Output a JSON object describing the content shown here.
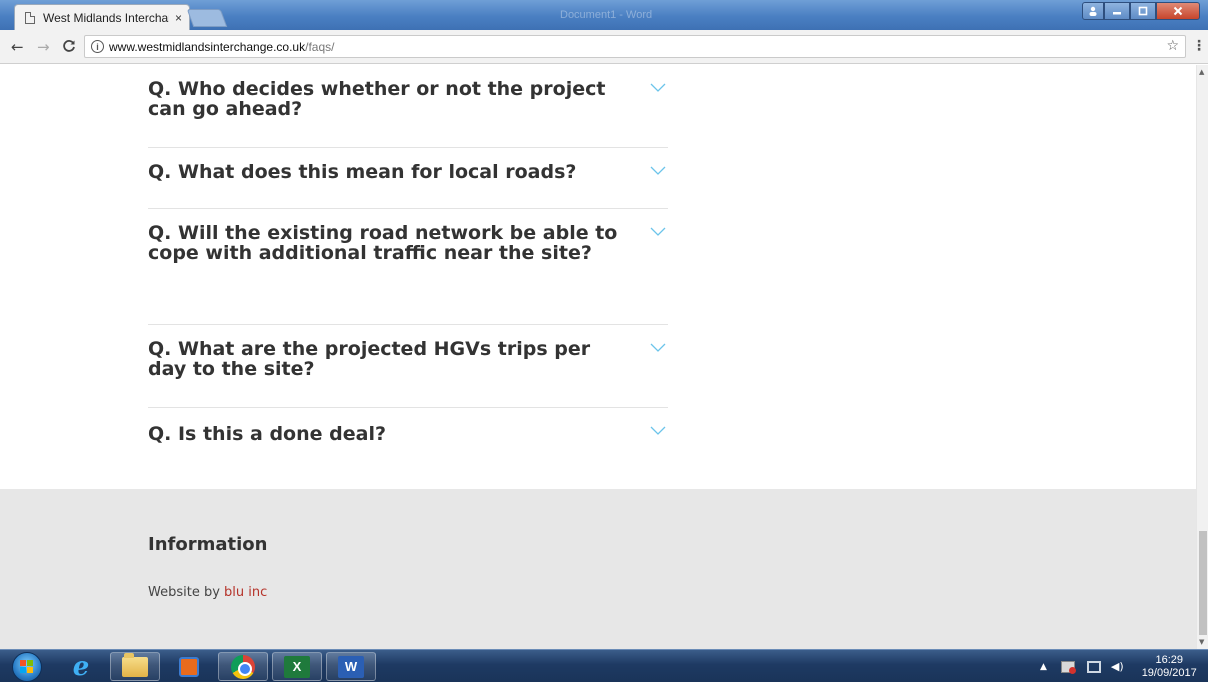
{
  "browser": {
    "tab_title": "West Midlands Interchange",
    "tab_close": "×",
    "window_title": "Document1 - Word",
    "url_host": "www.westmidlandsinterchange.co.uk",
    "url_path": "/faqs/"
  },
  "faqs": [
    {
      "question": "Q. Who decides whether or not the project can go ahead?"
    },
    {
      "question": "Q. What does this mean for local roads?"
    },
    {
      "question": "Q. Will the existing road network be able to cope with additional traffic near the site?"
    },
    {
      "question": "Q. What are the projected HGVs trips per day to the site?"
    },
    {
      "question": "Q. Is this a done deal?"
    }
  ],
  "footer": {
    "heading": "Information",
    "credit_prefix": "Website by ",
    "credit_link": "blu inc"
  },
  "taskbar": {
    "excel_label": "X",
    "word_label": "W",
    "clock_time": "16:29",
    "clock_date": "19/09/2017"
  },
  "colors": {
    "accent_chevron": "#6cc4ea",
    "footer_link": "#b5332a",
    "footer_bg": "#e7e7e7"
  },
  "icons": [
    "page-icon",
    "back-icon",
    "forward-icon",
    "reload-icon",
    "info-icon",
    "star-icon",
    "menu-icon",
    "chevron-down-icon",
    "start-icon",
    "ie-icon",
    "folder-icon",
    "media-player-icon",
    "chrome-icon",
    "excel-icon",
    "word-icon"
  ]
}
